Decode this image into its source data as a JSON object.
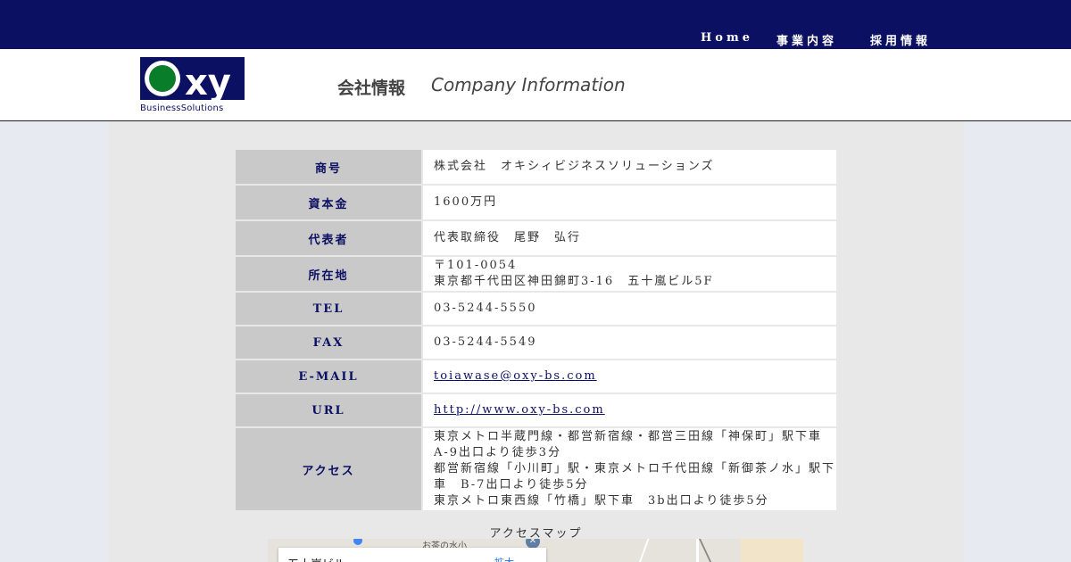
{
  "nav": {
    "home": "Home",
    "business": "事業内容",
    "recruit": "採用情報"
  },
  "colors": {
    "navy": "#0c1063",
    "logo_green": "#0a7d2a"
  },
  "logo": {
    "mark": "xy",
    "subtitle": "BusinessSolutions"
  },
  "header": {
    "title_jp": "会社情報",
    "title_en": "Company Information"
  },
  "company": {
    "rows": [
      {
        "label": "商号",
        "value": "株式会社　オキシィビジネスソリューションズ"
      },
      {
        "label": "資本金",
        "value": "1600万円"
      },
      {
        "label": "代表者",
        "value": "代表取締役　尾野　弘行"
      },
      {
        "label": "所在地",
        "value_lines": [
          "〒101-0054",
          "東京都千代田区神田錦町3-16　五十嵐ビル5F"
        ]
      },
      {
        "label": "TEL",
        "value": "03-5244-5550"
      },
      {
        "label": "FAX",
        "value": "03-5244-5549"
      },
      {
        "label": "E-MAIL",
        "link": "toiawase@oxy-bs.com"
      },
      {
        "label": "URL",
        "link": "http://www.oxy-bs.com"
      },
      {
        "label": "アクセス",
        "value_lines": [
          "東京メトロ半蔵門線・都営新宿線・都営三田線「神保町」駅下車",
          "A-9出口より徒歩3分",
          "都営新宿線「小川町」駅・東京メトロ千代田線「新御茶ノ水」駅下",
          "車　B-7出口より徒歩5分",
          "東京メトロ東西線「竹橋」駅下車　3b出口より徒歩5分"
        ]
      }
    ]
  },
  "map": {
    "heading": "アクセスマップ",
    "card_title": "五十嵐ビル",
    "station_label": "お茶の水小",
    "card_link": "拡大"
  }
}
